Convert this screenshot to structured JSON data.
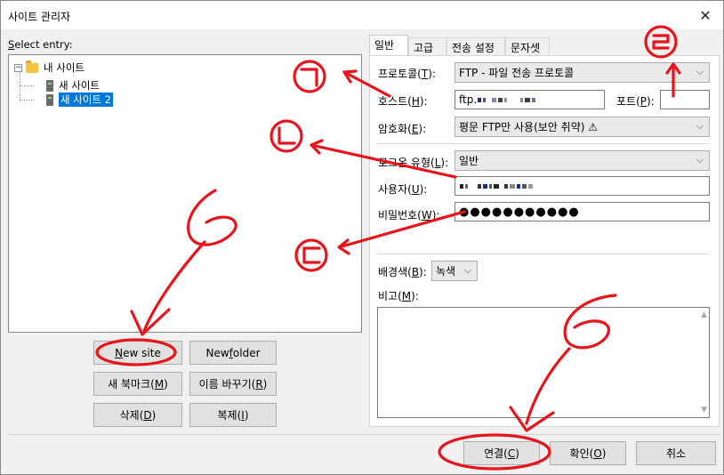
{
  "window": {
    "title": "사이트 관리자",
    "close_glyph": "✕"
  },
  "left": {
    "select_label_prefix": "S",
    "select_label_rest": "elect entry:",
    "tree": {
      "root": {
        "expander": "⊟",
        "label": "내 사이트"
      },
      "children": [
        {
          "label": "새 사이트",
          "selected": false
        },
        {
          "label": "새 사이트 2",
          "selected": true
        }
      ]
    },
    "buttons": {
      "new_site": {
        "prefix": "N",
        "rest": "ew site"
      },
      "new_folder": {
        "prefix": "New ",
        "ul": "f",
        "rest": "older"
      },
      "new_bookmark": {
        "prefix": "새 북마크(",
        "ul": "M",
        "rest": ")"
      },
      "rename": {
        "prefix": "이름 바꾸기(",
        "ul": "R",
        "rest": ")"
      },
      "delete": {
        "prefix": "삭제(",
        "ul": "D",
        "rest": ")"
      },
      "duplicate": {
        "prefix": "복제(",
        "ul": "I",
        "rest": ")"
      }
    }
  },
  "tabs": [
    {
      "label": "일반",
      "active": true
    },
    {
      "label": "고급",
      "active": false
    },
    {
      "label": "전송 설정",
      "active": false
    },
    {
      "label": "문자셋",
      "active": false
    }
  ],
  "general": {
    "protocol": {
      "label_prefix": "프로토콜(",
      "label_ul": "T",
      "label_rest": "):",
      "value": "FTP - 파일 전송 프로토콜"
    },
    "host": {
      "label_prefix": "호스트(",
      "label_ul": "H",
      "label_rest": "):",
      "value_visible": "ftp."
    },
    "port": {
      "label_prefix": "포트(",
      "label_ul": "P",
      "label_rest": "):",
      "value": ""
    },
    "encryption": {
      "label_prefix": "암호화(",
      "label_ul": "E",
      "label_rest": "):",
      "value": "평문 FTP만 사용(보안 취약) ⚠"
    },
    "logon_type": {
      "label_prefix": "로그온 유형(",
      "label_ul": "L",
      "label_rest": "):",
      "value": "일반"
    },
    "user": {
      "label_prefix": "사용자(",
      "label_ul": "U",
      "label_rest": "):"
    },
    "password": {
      "label_prefix": "비밀번호(",
      "label_ul": "W",
      "label_rest": "):",
      "value": "●●●●●●●●●●●"
    },
    "bg_color": {
      "label_prefix": "배경색(",
      "label_ul": "B",
      "label_rest": "):",
      "value": "녹색"
    },
    "comments": {
      "label_prefix": "비고(",
      "label_ul": "M",
      "label_rest": "):"
    }
  },
  "footer": {
    "connect": {
      "prefix": "연결(",
      "ul": "C",
      "rest": ")"
    },
    "ok": {
      "prefix": "확인(",
      "ul": "O",
      "rest": ")"
    },
    "cancel": {
      "label": "취소"
    }
  },
  "annotations": {
    "color": "#e8141b",
    "markers": [
      "ㄱ",
      "ㄴ",
      "ㄷ",
      "ㄹ"
    ]
  },
  "icons": {
    "folder": "folder-icon",
    "server": "server-icon",
    "dropdown": "chevron-down-icon",
    "warning": "warning-icon"
  }
}
